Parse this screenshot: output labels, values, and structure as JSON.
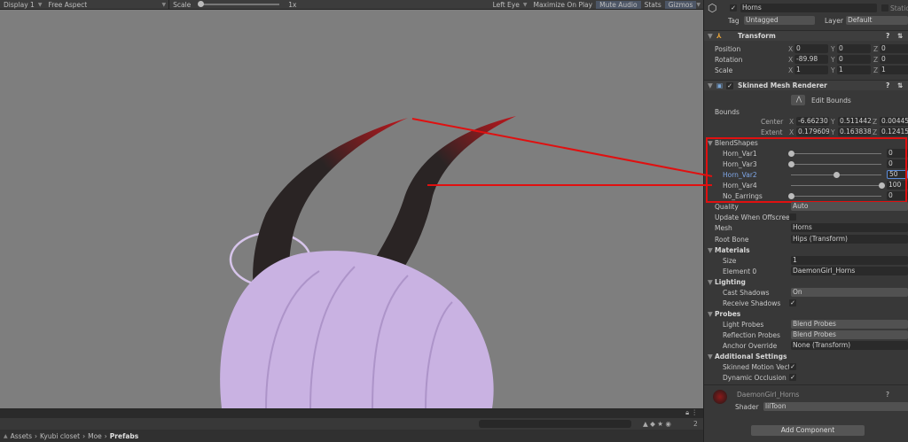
{
  "toolbar": {
    "display": "Display 1",
    "aspect": "Free Aspect",
    "scale_label": "Scale",
    "scale_value": "1x",
    "left_eye": "Left Eye",
    "maximize": "Maximize On Play",
    "mute": "Mute Audio",
    "stats": "Stats",
    "gizmos": "Gizmos"
  },
  "breadcrumb": [
    "Assets",
    "Kyubi closet",
    "Moe",
    "Prefabs"
  ],
  "project": {
    "hidden_count": "2"
  },
  "inspector": {
    "object_name": "Horns",
    "static_label": "Static",
    "tag_label": "Tag",
    "tag": "Untagged",
    "layer_label": "Layer",
    "layer": "Default",
    "transform": {
      "title": "Transform",
      "position": {
        "label": "Position",
        "x": "0",
        "y": "0",
        "z": "0"
      },
      "rotation": {
        "label": "Rotation",
        "x": "-89.98",
        "y": "0",
        "z": "0"
      },
      "scale": {
        "label": "Scale",
        "x": "1",
        "y": "1",
        "z": "1"
      }
    },
    "smr": {
      "title": "Skinned Mesh Renderer",
      "edit_bounds": "Edit Bounds",
      "bounds_label": "Bounds",
      "center": {
        "label": "Center",
        "x": "-6.66230",
        "y": "0.511442",
        "z": "0.00445"
      },
      "extent": {
        "label": "Extent",
        "x": "0.179609",
        "y": "0.163838",
        "z": "0.12415"
      },
      "blendshapes_title": "BlendShapes",
      "blendshapes": [
        {
          "name": "Horn_Var1",
          "value": 0
        },
        {
          "name": "Horn_Var3",
          "value": 0
        },
        {
          "name": "Horn_Var2",
          "value": 50
        },
        {
          "name": "Horn_Var4",
          "value": 100
        },
        {
          "name": "No_Earrings",
          "value": 0
        }
      ],
      "quality_label": "Quality",
      "quality": "Auto",
      "update_offscreen": "Update When Offscreen",
      "mesh_label": "Mesh",
      "mesh": "Horns",
      "root_bone_label": "Root Bone",
      "root_bone": "Hips (Transform)",
      "materials_title": "Materials",
      "size_label": "Size",
      "size": "1",
      "element0_label": "Element 0",
      "element0": "DaemonGirl_Horns",
      "lighting_title": "Lighting",
      "cast_shadows_label": "Cast Shadows",
      "cast_shadows": "On",
      "receive_shadows_label": "Receive Shadows",
      "probes_title": "Probes",
      "light_probes_label": "Light Probes",
      "light_probes": "Blend Probes",
      "reflection_probes_label": "Reflection Probes",
      "reflection_probes": "Blend Probes",
      "anchor_label": "Anchor Override",
      "anchor": "None (Transform)",
      "additional_title": "Additional Settings",
      "motion_vectors_label": "Skinned Motion Vecti",
      "dynamic_occlusion_label": "Dynamic Occlusion"
    },
    "material": {
      "name": "DaemonGirl_Horns",
      "shader_label": "Shader",
      "shader": "lilToon"
    },
    "add_component": "Add Component"
  },
  "colors": {
    "annotation": "#e01010",
    "selected_label": "#7fa7e8",
    "viewport_bg": "#7e7e7e",
    "hair": "#c9b2e2"
  }
}
